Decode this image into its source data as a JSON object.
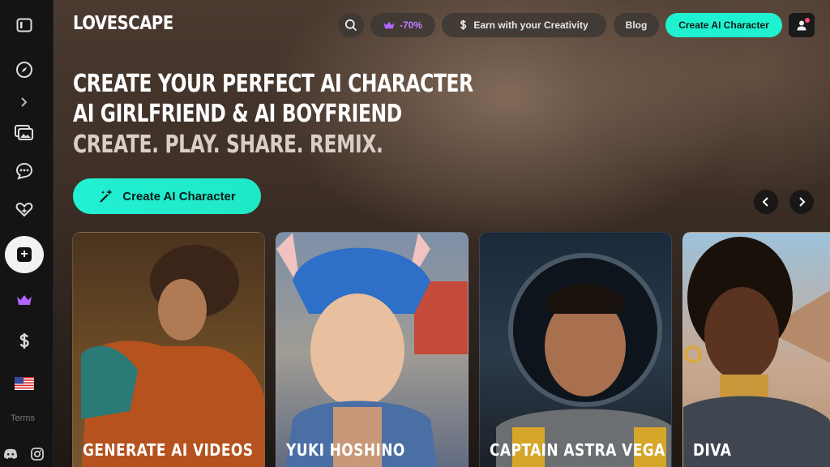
{
  "brand": {
    "logo_text": "LOVESCAPE"
  },
  "header": {
    "discount_label": "-70%",
    "earn_label": "Earn with your Creativity",
    "blog_label": "Blog",
    "create_label": "Create AI Character"
  },
  "hero": {
    "line1": "CREATE YOUR PERFECT AI CHARACTER",
    "line2": "AI GIRLFRIEND & AI BOYFRIEND",
    "line3": "CREATE. PLAY. SHARE. REMIX.",
    "cta_label": "Create AI Character"
  },
  "sidebar": {
    "terms_label": "Terms",
    "icons": [
      "sidebar-toggle-icon",
      "compass-icon",
      "chevron-right-icon",
      "gallery-icon",
      "chat-icon",
      "heart-sparkle-icon",
      "plus-icon",
      "crown-icon",
      "dollar-icon",
      "us-flag-icon",
      "discord-icon",
      "instagram-icon"
    ]
  },
  "cards": [
    {
      "title": "GENERATE AI VIDEOS"
    },
    {
      "title": "YUKI HOSHINO"
    },
    {
      "title": "CAPTAIN ASTRA VEGA"
    },
    {
      "title": "DIVA"
    }
  ],
  "colors": {
    "accent": "#1ff2d0",
    "crown": "#c77dff",
    "sidebar_bg": "#141414"
  }
}
